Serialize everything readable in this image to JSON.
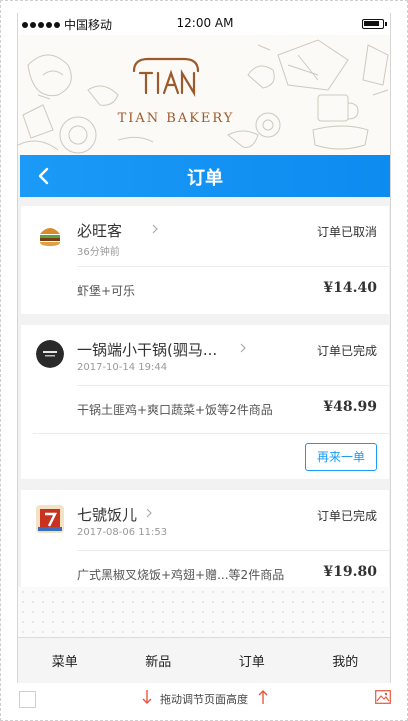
{
  "status_bar": {
    "carrier": "中国移动",
    "time": "12:00 AM"
  },
  "banner": {
    "logo_mark": "TIAN",
    "logo_text": "TIAN BAKERY"
  },
  "header": {
    "title": "订单"
  },
  "orders": [
    {
      "shop": "必旺客",
      "time": "36分钟前",
      "status": "订单已取消",
      "items": "虾堡+可乐",
      "price": "¥14.40",
      "reorder": ""
    },
    {
      "shop": "一锅端小干锅(驷马...",
      "time": "2017-10-14 19:44",
      "status": "订单已完成",
      "items": "干锅土匪鸡+爽口蔬菜+饭等2件商品",
      "price": "¥48.99",
      "reorder": "再来一单"
    },
    {
      "shop": "七號饭儿",
      "time": "2017-08-06 11:53",
      "status": "订单已完成",
      "items": "广式黑椒叉烧饭+鸡翅+赠...等2件商品",
      "price": "¥19.80",
      "reorder": ""
    }
  ],
  "tabs": [
    "菜单",
    "新品",
    "订单",
    "我的"
  ],
  "resize_bar": {
    "text": "拖动调节页面高度"
  },
  "colors": {
    "primary": "#1b9af7",
    "brand": "#9c5a2a",
    "arrow": "#e8573f"
  }
}
